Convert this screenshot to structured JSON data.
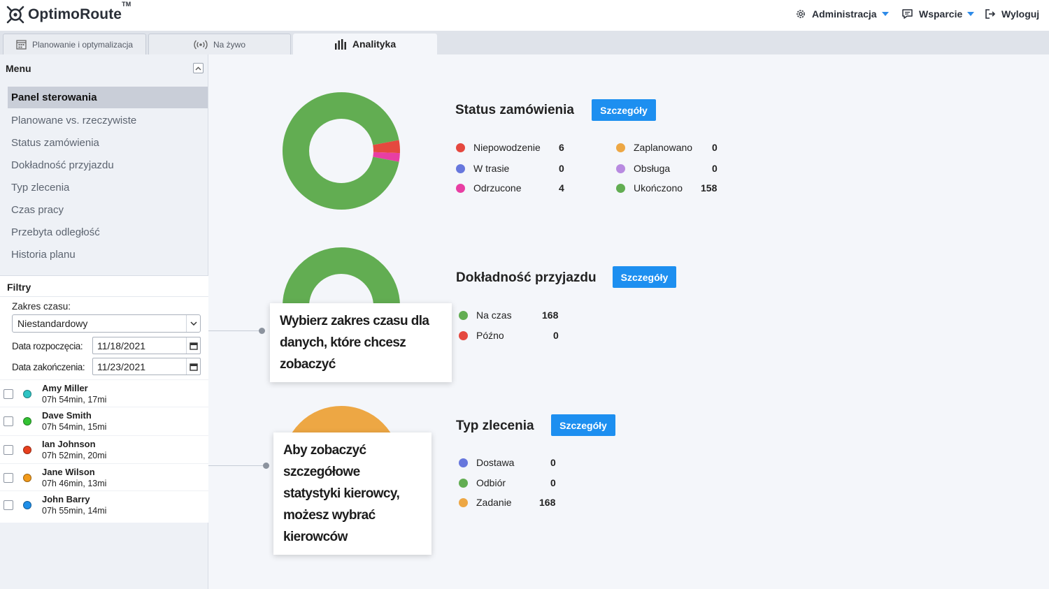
{
  "app": {
    "logo_text": "OptimoRoute",
    "logo_tm": "TM"
  },
  "header": {
    "admin_label": "Administracja",
    "support_label": "Wsparcie",
    "logout_label": "Wyloguj"
  },
  "tabs": [
    {
      "label": "Planowanie i optymalizacja",
      "active": false
    },
    {
      "label": "Na żywo",
      "active": false
    },
    {
      "label": "Analityka",
      "active": true
    }
  ],
  "sidebar": {
    "menu_title": "Menu",
    "items": [
      {
        "label": "Panel sterowania",
        "active": true
      },
      {
        "label": "Planowane vs. rzeczywiste",
        "active": false
      },
      {
        "label": "Status zamówienia",
        "active": false
      },
      {
        "label": "Dokładność przyjazdu",
        "active": false
      },
      {
        "label": "Typ zlecenia",
        "active": false
      },
      {
        "label": "Czas pracy",
        "active": false
      },
      {
        "label": "Przebyta odległość",
        "active": false
      },
      {
        "label": "Historia planu",
        "active": false
      }
    ]
  },
  "filters": {
    "title": "Filtry",
    "time_range_label": "Zakres czasu:",
    "time_range_value": "Niestandardowy",
    "start_label": "Data rozpoczęcia:",
    "start_value": "11/18/2021",
    "end_label": "Data zakończenia:",
    "end_value": "11/23/2021",
    "drivers": [
      {
        "name": "Amy Miller",
        "stats": "07h 54min, 17mi",
        "color": "#2ec4c4"
      },
      {
        "name": "Dave Smith",
        "stats": "07h 54min, 15mi",
        "color": "#33c233"
      },
      {
        "name": "Ian Johnson",
        "stats": "07h 52min, 20mi",
        "color": "#e8401e"
      },
      {
        "name": "Jane Wilson",
        "stats": "07h 46min, 13mi",
        "color": "#f29a1a"
      },
      {
        "name": "John Barry",
        "stats": "07h 55min, 14mi",
        "color": "#1e8ee8"
      }
    ]
  },
  "sections": {
    "order_status": {
      "title": "Status zamówienia",
      "details_label": "Szczegóły",
      "legend": [
        {
          "label": "Niepowodzenie",
          "value": "6",
          "color": "#e5483f"
        },
        {
          "label": "W trasie",
          "value": "0",
          "color": "#6777dd"
        },
        {
          "label": "Odrzucone",
          "value": "4",
          "color": "#e83ea3"
        },
        {
          "label": "Zaplanowano",
          "value": "0",
          "color": "#eda744"
        },
        {
          "label": "Obsługa",
          "value": "0",
          "color": "#b88ae0"
        },
        {
          "label": "Ukończono",
          "value": "158",
          "color": "#62ad52"
        }
      ]
    },
    "arrival_accuracy": {
      "title": "Dokładność przyjazdu",
      "details_label": "Szczegóły",
      "legend": [
        {
          "label": "Na czas",
          "value": "168",
          "color": "#62ad52"
        },
        {
          "label": "Późno",
          "value": "0",
          "color": "#e5483f"
        }
      ]
    },
    "order_type": {
      "title": "Typ zlecenia",
      "details_label": "Szczegóły",
      "legend": [
        {
          "label": "Dostawa",
          "value": "0",
          "color": "#6777dd"
        },
        {
          "label": "Odbiór",
          "value": "0",
          "color": "#62ad52"
        },
        {
          "label": "Zadanie",
          "value": "168",
          "color": "#eda744"
        }
      ]
    }
  },
  "tooltips": {
    "time_range": {
      "line1": "Wybierz zakres czasu dla",
      "line2": "danych, które chcesz zobaczyć"
    },
    "drivers": {
      "line1": "Aby zobaczyć szczegółowe",
      "line2": "statystyki kierowcy,",
      "line3": "możesz wybrać kierowców"
    }
  }
}
